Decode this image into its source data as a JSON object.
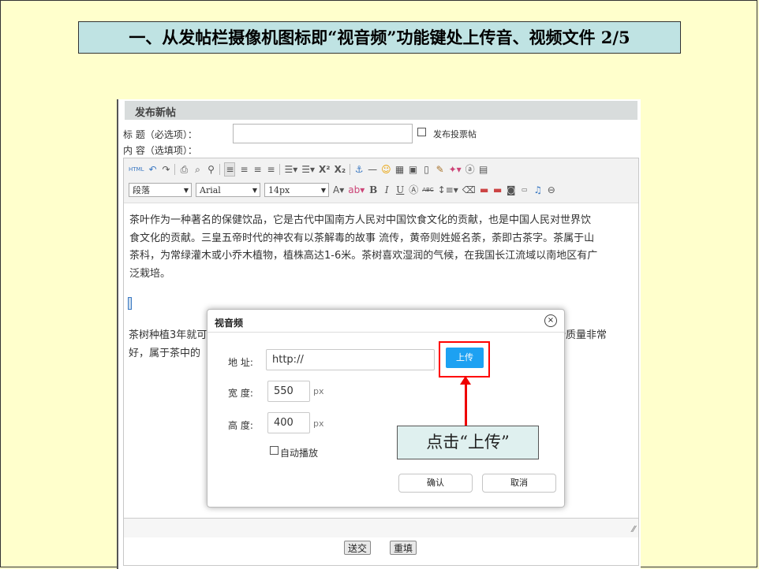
{
  "slide": {
    "title": "一、从发帖栏摄像机图标即“视音频”功能键处上传音、视频文件 2/5",
    "callout": "点击“上传”"
  },
  "form": {
    "header": "发布新帖",
    "title_label": "标  题（必选项）：",
    "content_label": "内  容（选填项）：",
    "poll_label": "发布投票帖",
    "submit": "送交",
    "reset": "重填"
  },
  "toolbar": {
    "paragraph": "段落",
    "font": "Arial",
    "size": "14px"
  },
  "content": {
    "paragraph1_lines": [
      "茶叶作为一种著名的保健饮品，它是古代中国南方人民对中国饮食文化的贡献，也是中国人民对世界饮",
      "食文化的贡献。三皇五帝时代的神农有以茶解毒的故事 流传，黄帝则姓姬名荼，荼即古茶字。茶属于山",
      "茶科，为常绿灌木或小乔木植物，植株高达1-6米。茶树喜欢湿润的气候，在我国长江流域以南地区有广",
      "泛栽培。"
    ],
    "paragraph2_left_lines": [
      "茶树种植3年就可",
      "好，属于茶中的"
    ],
    "paragraph2_right": "叶质量非常"
  },
  "dialog": {
    "title": "视音频",
    "close_symbol": "×",
    "address_label": "地 址:",
    "address_value": "http://",
    "upload": "上传",
    "width_label": "宽 度:",
    "width_value": "550",
    "height_label": "高 度:",
    "height_value": "400",
    "unit": "px",
    "autoplay_label": "自动播放",
    "confirm": "确认",
    "cancel": "取消"
  }
}
